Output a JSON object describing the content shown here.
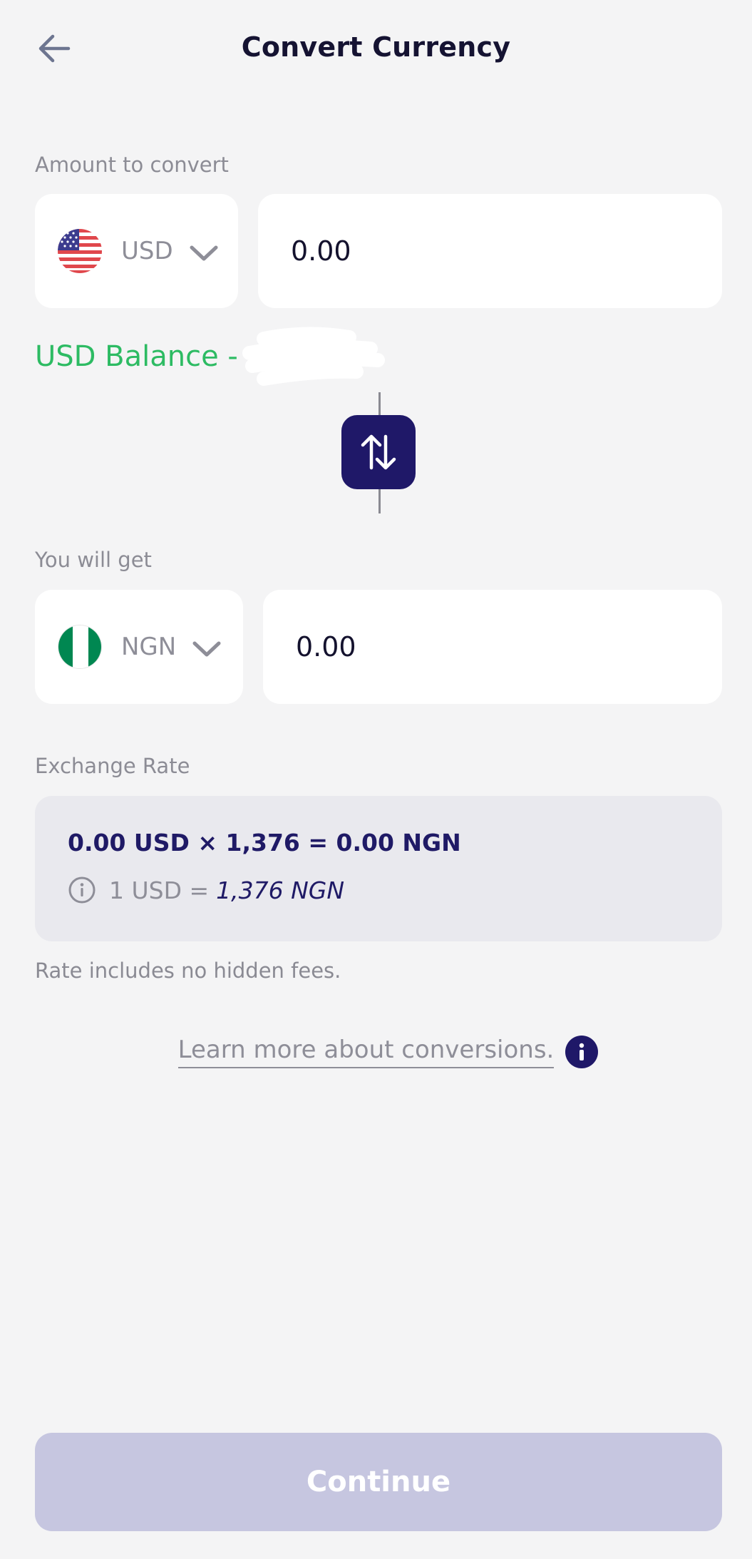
{
  "header": {
    "title": "Convert Currency",
    "back_icon": "arrow-left-icon"
  },
  "from": {
    "label": "Amount to convert",
    "currency": "USD",
    "flag_icon": "us-flag-icon",
    "amount_value": "0.00",
    "balance_label": "USD Balance -"
  },
  "swap": {
    "icon": "swap-vertical-arrows-icon"
  },
  "to": {
    "label": "You will get",
    "currency": "NGN",
    "flag_icon": "nigeria-flag-icon",
    "amount_value": "0.00"
  },
  "rate": {
    "label": "Exchange Rate",
    "formula": "0.00 USD × 1,376 = 0.00 NGN",
    "info_prefix": "1 USD =",
    "info_value": "1,376 NGN",
    "note": "Rate includes no hidden fees."
  },
  "learn_more": {
    "text": "Learn more about conversions."
  },
  "continue_label": "Continue",
  "colors": {
    "accent": "#1f1868",
    "balance_green": "#2dbb63",
    "button_disabled": "#c6c6e0",
    "background": "#f4f4f5"
  }
}
